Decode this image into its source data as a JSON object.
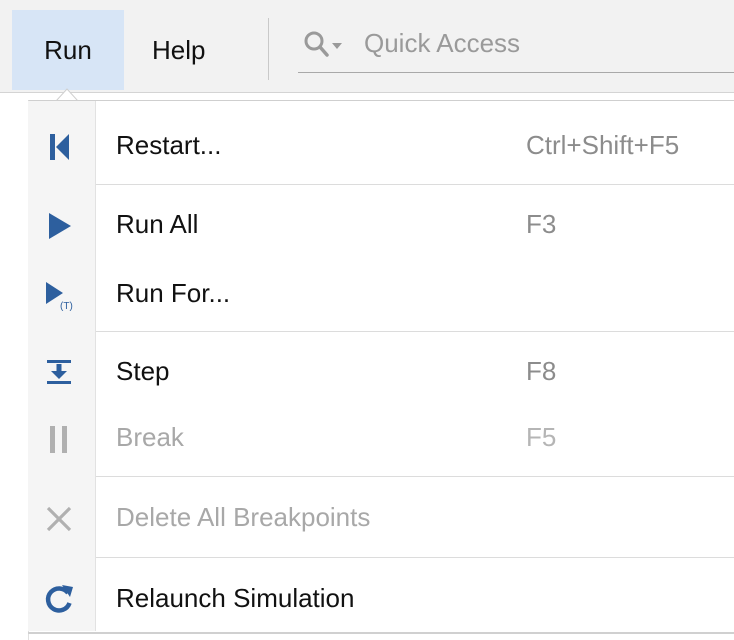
{
  "menubar": {
    "run_label": "Run",
    "help_label": "Help",
    "quick_access_placeholder": "Quick Access"
  },
  "menu": {
    "items": [
      {
        "label": "Restart...",
        "shortcut": "Ctrl+Shift+F5",
        "icon": "restart-icon",
        "enabled": true
      },
      {
        "label": "Run All",
        "shortcut": "F3",
        "icon": "play-icon",
        "enabled": true
      },
      {
        "label": "Run For...",
        "shortcut": "",
        "icon": "run-for-icon",
        "enabled": true
      },
      {
        "label": "Step",
        "shortcut": "F8",
        "icon": "step-icon",
        "enabled": true
      },
      {
        "label": "Break",
        "shortcut": "F5",
        "icon": "pause-icon",
        "enabled": false
      },
      {
        "label": "Delete All Breakpoints",
        "shortcut": "",
        "icon": "close-icon",
        "enabled": false
      },
      {
        "label": "Relaunch Simulation",
        "shortcut": "",
        "icon": "relaunch-icon",
        "enabled": true
      }
    ],
    "run_for_badge": "(T)"
  },
  "colors": {
    "accent_blue": "#2d5f9e",
    "active_menu_bg": "#d7e5f6",
    "disabled": "#a8a8a8"
  }
}
